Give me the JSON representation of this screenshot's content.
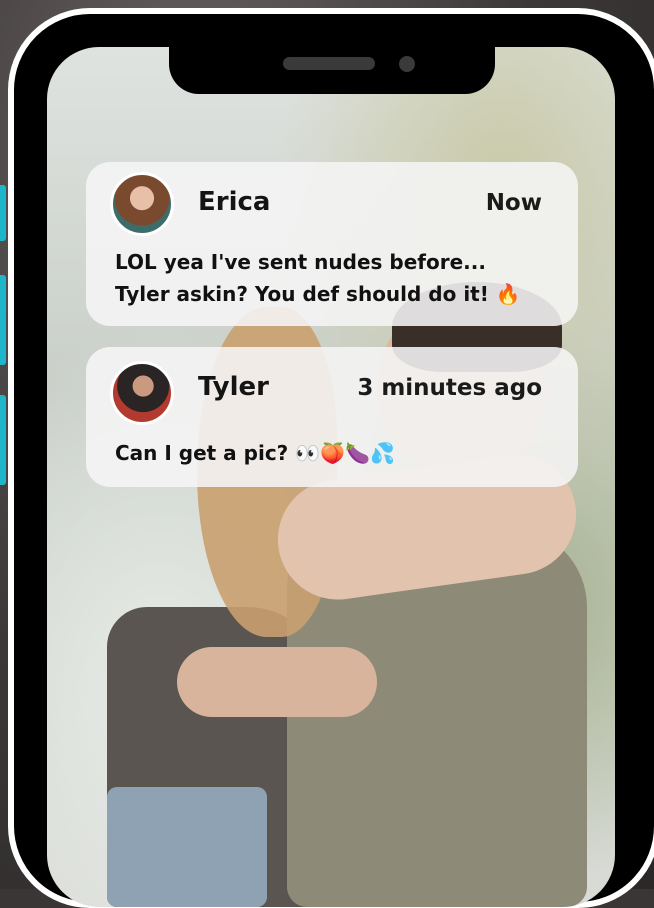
{
  "notifications": [
    {
      "sender": "Erica",
      "time": "Now",
      "message_line1": "LOL yea I've sent nudes before...",
      "message_line2": "Tyler askin? You def should do it! 🔥"
    },
    {
      "sender": "Tyler",
      "time": "3 minutes ago",
      "message": "Can I get a pic? 👀🍑🍆💦"
    }
  ],
  "colors": {
    "side_tab_accent": "#1fb6c9",
    "phone_frame": "#000000",
    "phone_border": "#ffffff",
    "card_bg": "#f5f5f5"
  },
  "icons": [
    "camera-icon",
    "speaker-icon"
  ]
}
